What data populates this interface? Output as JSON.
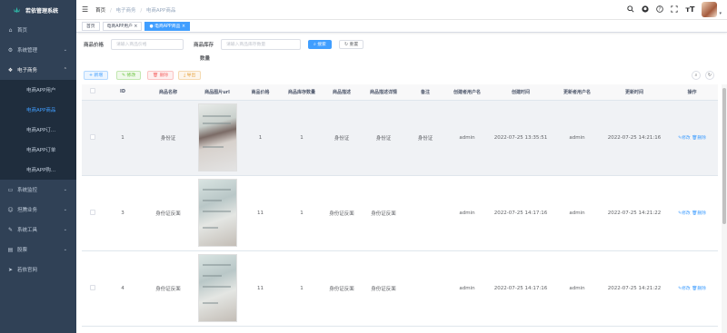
{
  "app": {
    "title": "若依管理系统"
  },
  "sidebar": {
    "items": [
      {
        "label": "首页",
        "icon": "dashboard-icon",
        "ic": "⌂"
      },
      {
        "label": "系统管理",
        "icon": "gear-icon",
        "ic": "⚙"
      },
      {
        "label": "电子商务",
        "icon": "shop-icon",
        "ic": "❖"
      }
    ],
    "sub_items": [
      {
        "label": "电商APP用户"
      },
      {
        "label": "电商APP商品"
      },
      {
        "label": "电商APP订..."
      },
      {
        "label": "电商APP订单"
      },
      {
        "label": "电商APP购..."
      }
    ],
    "lower_items": [
      {
        "label": "系统监控",
        "icon": "monitor-icon",
        "ic": "▭"
      },
      {
        "label": "坦腾业务",
        "icon": "user-icon",
        "ic": "☺"
      },
      {
        "label": "系统工具",
        "icon": "tool-icon",
        "ic": "✎"
      },
      {
        "label": "股票",
        "icon": "chart-icon",
        "ic": "▤"
      },
      {
        "label": "若依官网",
        "icon": "send-icon",
        "ic": "➤"
      }
    ]
  },
  "breadcrumb": {
    "home": "首页",
    "sep1": "/",
    "mid": "电子商务",
    "sep2": "/",
    "last": "电商APP商品"
  },
  "tags": {
    "home": "首页",
    "user": "电商APP用户",
    "product": "电商APP商品"
  },
  "search": {
    "price_label": "商品价格",
    "price_placeholder": "请输入商品价格",
    "stock_label": "商品库存",
    "stock_placeholder": "请输入商品库存数量",
    "stock_label2": "数量",
    "search_btn": "搜索",
    "reset_btn": "重置"
  },
  "toolbar": {
    "add": "+ 新增",
    "edit": "✎ 修改",
    "delete": "🗑 删除",
    "export": "⤓ 导出"
  },
  "table": {
    "headers": [
      "",
      "ID",
      "商品名称",
      "商品图片url",
      "商品价格",
      "商品库存数量",
      "商品描述",
      "商品描述详情",
      "备注",
      "创建者用户名",
      "创建时间",
      "更新者用户名",
      "更新时间",
      "操作"
    ],
    "rows": [
      {
        "id": "1",
        "name": "身份证",
        "price": "1",
        "stock": "1",
        "desc": "身份证",
        "detail": "身份证",
        "remark": "身份证",
        "creator": "admin",
        "created": "2022-07-25 13:35:51",
        "updater": "admin",
        "updated": "2022-07-25 14:21:16"
      },
      {
        "id": "3",
        "name": "身份证反面",
        "price": "11",
        "stock": "1",
        "desc": "身份证反面",
        "detail": "身份证反面",
        "remark": "",
        "creator": "admin",
        "created": "2022-07-25 14:17:16",
        "updater": "admin",
        "updated": "2022-07-25 14:21:22"
      },
      {
        "id": "4",
        "name": "身份证反面",
        "price": "11",
        "stock": "1",
        "desc": "身份证反面",
        "detail": "身份证反面",
        "remark": "",
        "creator": "admin",
        "created": "2022-07-25 14:17:16",
        "updater": "admin",
        "updated": "2022-07-25 14:21:22"
      }
    ],
    "edit_op": "✎修改",
    "delete_op": "🗑删除"
  },
  "colors": {
    "sidebar": "#304156",
    "accent": "#409eff"
  }
}
